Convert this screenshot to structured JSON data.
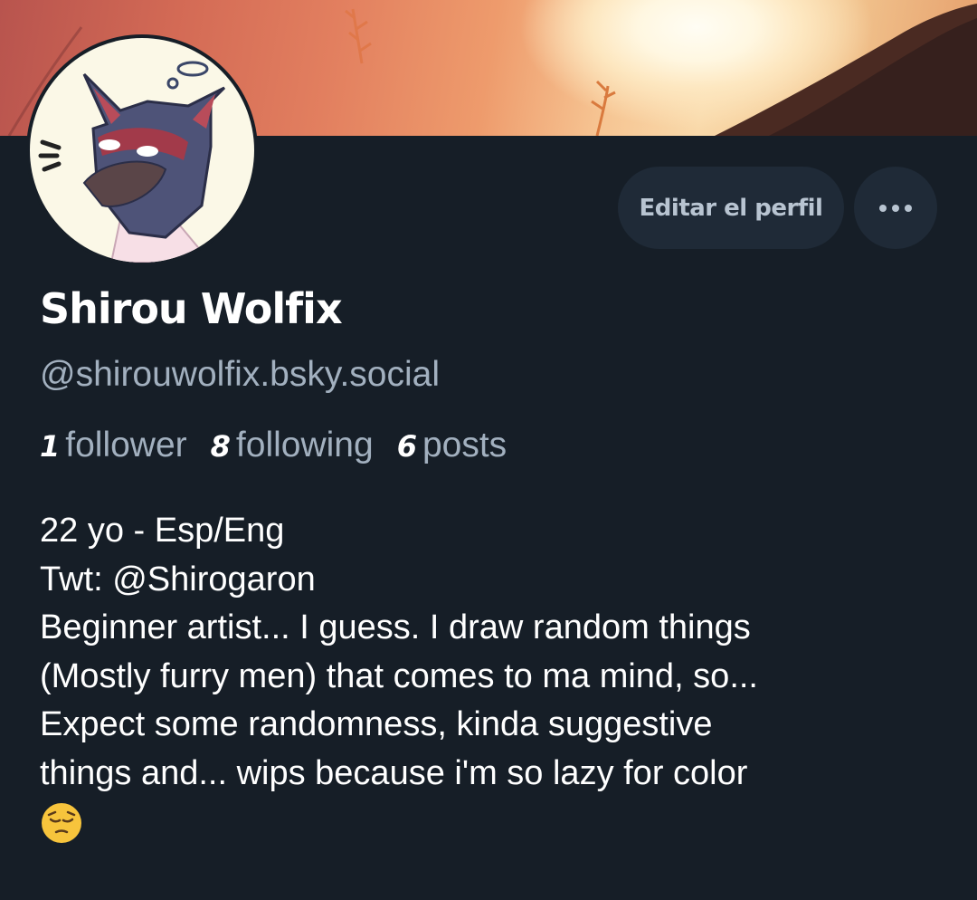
{
  "profile": {
    "display_name": "Shirou Wolfix",
    "handle": "@shirouwolfix.bsky.social",
    "stats": {
      "followers_count": "1",
      "followers_label": "follower",
      "following_count": "8",
      "following_label": "following",
      "posts_count": "6",
      "posts_label": "posts"
    },
    "bio_lines": [
      "22 yo - Esp/Eng",
      "Twt: @Shirogaron",
      "Beginner artist... I guess. I draw random things",
      "(Mostly furry men) that comes to ma mind, so...",
      "Expect some randomness, kinda suggestive",
      "things and... wips because i'm so lazy for color"
    ],
    "bio_emoji": "pensive-face-emoji"
  },
  "actions": {
    "edit_profile_label": "Editar el perfil",
    "more_icon": "ellipsis-icon"
  },
  "colors": {
    "background": "#161e27",
    "button_bg": "#1f2a37",
    "muted_text": "#a2b0bf",
    "button_text": "#b8c4d1"
  }
}
